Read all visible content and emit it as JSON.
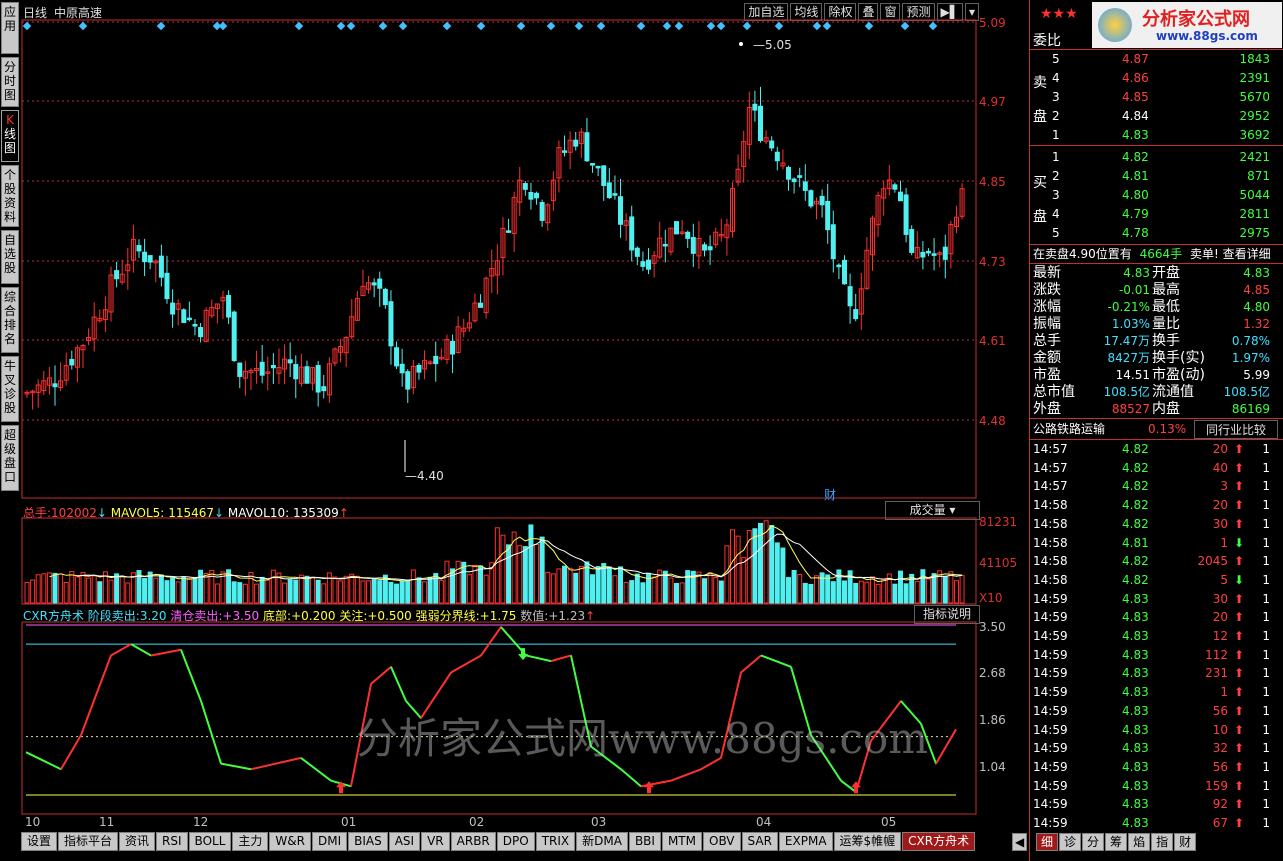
{
  "left_tabs": [
    "应用",
    "分时图",
    "K线图",
    "个股资料",
    "自选股",
    "综合排名",
    "牛叉诊股",
    "超级盘口"
  ],
  "header": {
    "period": "日线",
    "stock_name": "中原高速"
  },
  "toolbar": [
    "加自选",
    "均线",
    "除权",
    "叠",
    "窗",
    "预测"
  ],
  "price_axis": [
    "5.09",
    "4.97",
    "4.85",
    "4.73",
    "4.61",
    "4.48"
  ],
  "price_marks": {
    "high": "5.05",
    "low": "4.40",
    "cai": "财"
  },
  "volume": {
    "label": "总手:",
    "value": "102002",
    "ma5_label": "MAVOL5:",
    "ma5": "115467",
    "ma10_label": "MAVOL10:",
    "ma10": "135309",
    "dropdown": "成交量",
    "axis": [
      "81231",
      "41105"
    ],
    "unit": "X10"
  },
  "indicator": {
    "name": "CXR方舟术",
    "items": [
      {
        "label": "阶段卖出:",
        "value": "3.20"
      },
      {
        "label": "清仓卖出:",
        "value": "+3.50"
      },
      {
        "label": "底部:",
        "value": "+0.200"
      },
      {
        "label": "关注:",
        "value": "+0.500"
      },
      {
        "label": "强弱分界线:",
        "value": "+1.75"
      },
      {
        "label": "数值:",
        "value": "+1.23"
      }
    ],
    "explain": "指标说明",
    "axis": [
      "3.50",
      "2.68",
      "1.86",
      "1.04"
    ]
  },
  "months": [
    "10",
    "11",
    "12",
    "01",
    "02",
    "03",
    "04",
    "05"
  ],
  "watermark": "分析家公式网www.88gs.com",
  "bottom_tabs": [
    "设置",
    "指标平台",
    "资讯",
    "RSI",
    "BOLL",
    "主力",
    "W&R",
    "DMI",
    "BIAS",
    "ASI",
    "VR",
    "ARBR",
    "DPO",
    "TRIX",
    "新DMA",
    "BBI",
    "MTM",
    "OBV",
    "SAR",
    "EXPMA",
    "运筹$帷幄",
    "CXR方舟术"
  ],
  "right": {
    "logo": "分析家公式网",
    "logo_url": "www.88gs.com",
    "weibi": "委比",
    "sell_label": [
      "卖",
      "盘"
    ],
    "buy_label": [
      "买",
      "盘"
    ],
    "sells": [
      {
        "n": "5",
        "p": "4.87",
        "v": "1843"
      },
      {
        "n": "4",
        "p": "4.86",
        "v": "2391"
      },
      {
        "n": "3",
        "p": "4.85",
        "v": "5670"
      },
      {
        "n": "2",
        "p": "4.84",
        "v": "2952"
      },
      {
        "n": "1",
        "p": "4.83",
        "v": "3692"
      }
    ],
    "buys": [
      {
        "n": "1",
        "p": "4.82",
        "v": "2421"
      },
      {
        "n": "2",
        "p": "4.81",
        "v": "871"
      },
      {
        "n": "3",
        "p": "4.80",
        "v": "5044"
      },
      {
        "n": "4",
        "p": "4.79",
        "v": "2811"
      },
      {
        "n": "5",
        "p": "4.78",
        "v": "2975"
      }
    ],
    "notice": {
      "text": "在卖盘4.90位置有",
      "qty": "4664手",
      "action": "卖单! 查看详细"
    },
    "quotes": [
      {
        "l": "最新",
        "v": "4.83",
        "l2": "开盘",
        "v2": "4.83"
      },
      {
        "l": "涨跌",
        "v": "-0.01",
        "l2": "最高",
        "v2": "4.85"
      },
      {
        "l": "涨幅",
        "v": "-0.21%",
        "l2": "最低",
        "v2": "4.80"
      },
      {
        "l": "振幅",
        "v": "1.03%",
        "l2": "量比",
        "v2": "1.32"
      },
      {
        "l": "总手",
        "v": "17.47万",
        "l2": "换手",
        "v2": "0.78%"
      },
      {
        "l": "金额",
        "v": "8427万",
        "l2": "换手(实)",
        "v2": "1.97%"
      },
      {
        "l": "市盈",
        "v": "14.51",
        "l2": "市盈(动)",
        "v2": "5.99"
      },
      {
        "l": "总市值",
        "v": "108.5亿",
        "l2": "流通值",
        "v2": "108.5亿"
      },
      {
        "l": "外盘",
        "v": "88527",
        "l2": "内盘",
        "v2": "86169"
      }
    ],
    "industry": {
      "name": "公路铁路运输",
      "pct": "0.13%",
      "compare": "同行业比较"
    },
    "ticks": [
      {
        "t": "14:57",
        "p": "4.82",
        "v": "20",
        "d": "up",
        "n": "1"
      },
      {
        "t": "14:57",
        "p": "4.82",
        "v": "40",
        "d": "up",
        "n": "1"
      },
      {
        "t": "14:57",
        "p": "4.82",
        "v": "3",
        "d": "up",
        "n": "1"
      },
      {
        "t": "14:58",
        "p": "4.82",
        "v": "20",
        "d": "up",
        "n": "1"
      },
      {
        "t": "14:58",
        "p": "4.82",
        "v": "30",
        "d": "up",
        "n": "1"
      },
      {
        "t": "14:58",
        "p": "4.81",
        "v": "1",
        "d": "down",
        "n": "1"
      },
      {
        "t": "14:58",
        "p": "4.82",
        "v": "2045",
        "d": "up",
        "n": "1"
      },
      {
        "t": "14:58",
        "p": "4.82",
        "v": "5",
        "d": "down",
        "n": "1"
      },
      {
        "t": "14:59",
        "p": "4.83",
        "v": "30",
        "d": "up",
        "n": "1"
      },
      {
        "t": "14:59",
        "p": "4.83",
        "v": "20",
        "d": "up",
        "n": "1"
      },
      {
        "t": "14:59",
        "p": "4.83",
        "v": "12",
        "d": "up",
        "n": "1"
      },
      {
        "t": "14:59",
        "p": "4.83",
        "v": "112",
        "d": "up",
        "n": "1"
      },
      {
        "t": "14:59",
        "p": "4.83",
        "v": "231",
        "d": "up",
        "n": "1"
      },
      {
        "t": "14:59",
        "p": "4.83",
        "v": "1",
        "d": "up",
        "n": "1"
      },
      {
        "t": "14:59",
        "p": "4.83",
        "v": "56",
        "d": "up",
        "n": "1"
      },
      {
        "t": "14:59",
        "p": "4.83",
        "v": "10",
        "d": "up",
        "n": "1"
      },
      {
        "t": "14:59",
        "p": "4.83",
        "v": "32",
        "d": "up",
        "n": "1"
      },
      {
        "t": "14:59",
        "p": "4.83",
        "v": "56",
        "d": "up",
        "n": "1"
      },
      {
        "t": "14:59",
        "p": "4.83",
        "v": "159",
        "d": "up",
        "n": "1"
      },
      {
        "t": "14:59",
        "p": "4.83",
        "v": "92",
        "d": "up",
        "n": "1"
      },
      {
        "t": "14:59",
        "p": "4.83",
        "v": "67",
        "d": "up",
        "n": "1"
      }
    ],
    "tabs": [
      "细",
      "诊",
      "分",
      "筹",
      "焰",
      "指",
      "财"
    ]
  },
  "colors": {
    "up": "#ff3030",
    "down": "#50f0f0",
    "frame": "#c03030"
  }
}
